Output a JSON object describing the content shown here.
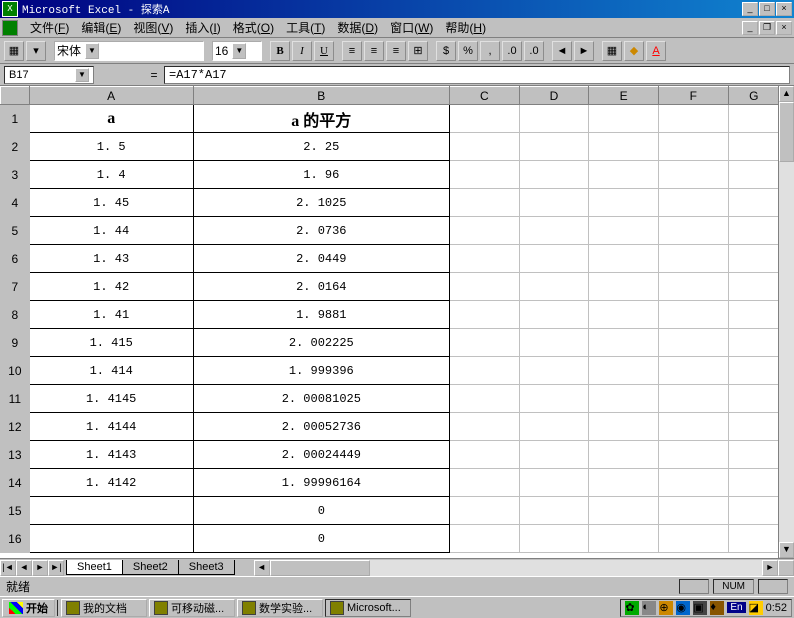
{
  "titlebar": {
    "app": "Microsoft Excel",
    "doc": "探索A"
  },
  "menus": [
    {
      "label": "文件",
      "key": "F"
    },
    {
      "label": "编辑",
      "key": "E"
    },
    {
      "label": "视图",
      "key": "V"
    },
    {
      "label": "插入",
      "key": "I"
    },
    {
      "label": "格式",
      "key": "O"
    },
    {
      "label": "工具",
      "key": "T"
    },
    {
      "label": "数据",
      "key": "D"
    },
    {
      "label": "窗口",
      "key": "W"
    },
    {
      "label": "帮助",
      "key": "H"
    }
  ],
  "toolbar": {
    "font": "宋体",
    "size": "16"
  },
  "formulabar": {
    "cellref": "B17",
    "formula": "=A17*A17"
  },
  "columns": [
    "A",
    "B",
    "C",
    "D",
    "E",
    "F",
    "G"
  ],
  "rows": [
    {
      "n": 1,
      "a": "a",
      "b": "a 的平方",
      "header": true
    },
    {
      "n": 2,
      "a": "1. 5",
      "b": "2. 25"
    },
    {
      "n": 3,
      "a": "1. 4",
      "b": "1. 96"
    },
    {
      "n": 4,
      "a": "1. 45",
      "b": "2. 1025"
    },
    {
      "n": 5,
      "a": "1. 44",
      "b": "2. 0736"
    },
    {
      "n": 6,
      "a": "1. 43",
      "b": "2. 0449"
    },
    {
      "n": 7,
      "a": "1. 42",
      "b": "2. 0164"
    },
    {
      "n": 8,
      "a": "1. 41",
      "b": "1. 9881"
    },
    {
      "n": 9,
      "a": "1. 415",
      "b": "2. 002225"
    },
    {
      "n": 10,
      "a": "1. 414",
      "b": "1. 999396"
    },
    {
      "n": 11,
      "a": "1. 4145",
      "b": "2. 00081025"
    },
    {
      "n": 12,
      "a": "1. 4144",
      "b": "2. 00052736"
    },
    {
      "n": 13,
      "a": "1. 4143",
      "b": "2. 00024449"
    },
    {
      "n": 14,
      "a": "1. 4142",
      "b": "1. 99996164"
    },
    {
      "n": 15,
      "a": "",
      "b": "0"
    },
    {
      "n": 16,
      "a": "",
      "b": "0"
    }
  ],
  "sheets": [
    "Sheet1",
    "Sheet2",
    "Sheet3"
  ],
  "status": {
    "text": "就绪",
    "num": "NUM"
  },
  "taskbar": {
    "start": "开始",
    "items": [
      "我的文档",
      "可移动磁...",
      "数学实验...",
      "Microsoft..."
    ],
    "clock": "0:52",
    "ime": "En"
  }
}
